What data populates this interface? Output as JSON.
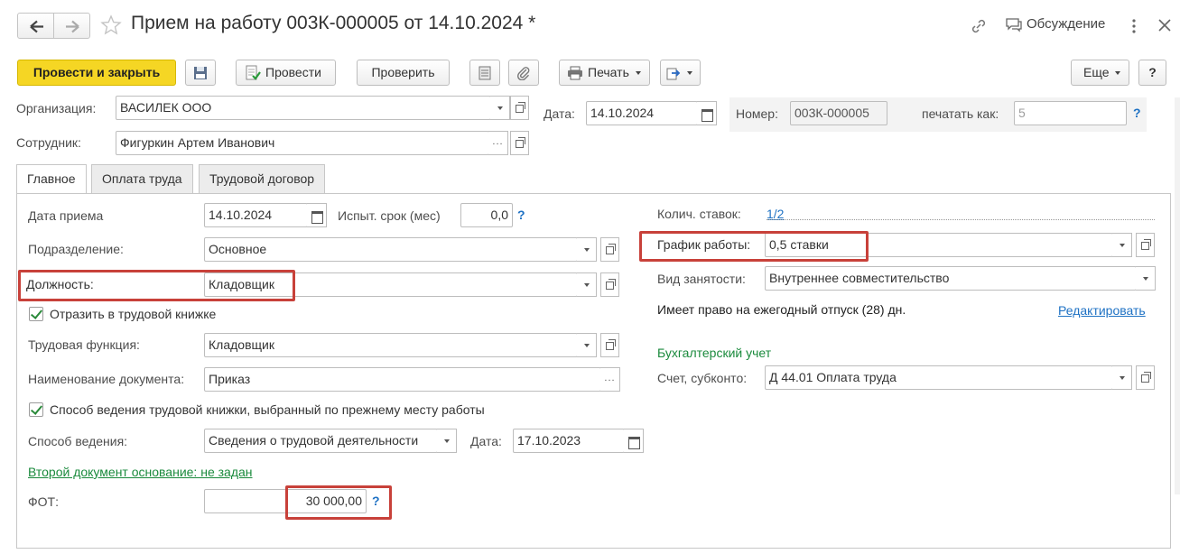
{
  "header": {
    "title": "Прием на работу 003К-000005 от 14.10.2024 *",
    "discussion_label": "Обсуждение"
  },
  "toolbar": {
    "post_close_label": "Провести и закрыть",
    "post_label": "Провести",
    "check_label": "Проверить",
    "print_label": "Печать",
    "more_label": "Еще",
    "help_label": "?"
  },
  "form": {
    "organization_label": "Организация:",
    "organization_value": "ВАСИЛЕК ООО",
    "date_label": "Дата:",
    "date_value": "14.10.2024",
    "number_label": "Номер:",
    "number_value": "003К-000005",
    "print_as_label": "печатать как:",
    "print_as_placeholder": "5",
    "employee_label": "Сотрудник:",
    "employee_value": "Фигуркин Артем Иванович"
  },
  "tabs": [
    {
      "label": "Главное"
    },
    {
      "label": "Оплата труда"
    },
    {
      "label": "Трудовой договор"
    }
  ],
  "main": {
    "hire_date_label": "Дата приема",
    "hire_date_value": "14.10.2024",
    "probation_label": "Испыт. срок (мес)",
    "probation_value": "0,0",
    "department_label": "Подразделение:",
    "department_value": "Основное",
    "position_label": "Должность:",
    "position_value": "Кладовщик",
    "record_in_book_label": "Отразить в трудовой книжке",
    "labor_function_label": "Трудовая функция:",
    "labor_function_value": "Кладовщик",
    "doc_name_label": "Наименование документа:",
    "doc_name_value": "Приказ",
    "book_method_label": "Способ ведения трудовой книжки, выбранный по прежнему месту работы",
    "method_label": "Способ ведения:",
    "method_value": "Сведения о трудовой деятельности",
    "method_date_label": "Дата:",
    "method_date_value": "17.10.2023",
    "second_doc_link": "Второй документ основание: не задан",
    "fot_label": "ФОТ:",
    "fot_value": "30 000,00",
    "rates_count_label": "Колич. ставок:",
    "rates_count_value": "1/2",
    "schedule_label": "График работы:",
    "schedule_value": "0,5 ставки",
    "employment_type_label": "Вид занятости:",
    "employment_type_value": "Внутреннее совместительство",
    "vacation_text": "Имеет право на ежегодный отпуск (28) дн.",
    "edit_link": "Редактировать",
    "accounting_heading": "Бухгалтерский учет",
    "account_label": "Счет, субконто:",
    "account_value": "Д 44.01 Оплата труда"
  },
  "colors": {
    "primary_button": "#f5d624",
    "highlight_box": "#c8413a",
    "link_blue": "#1f72c4",
    "link_green": "#1a8a3c"
  }
}
